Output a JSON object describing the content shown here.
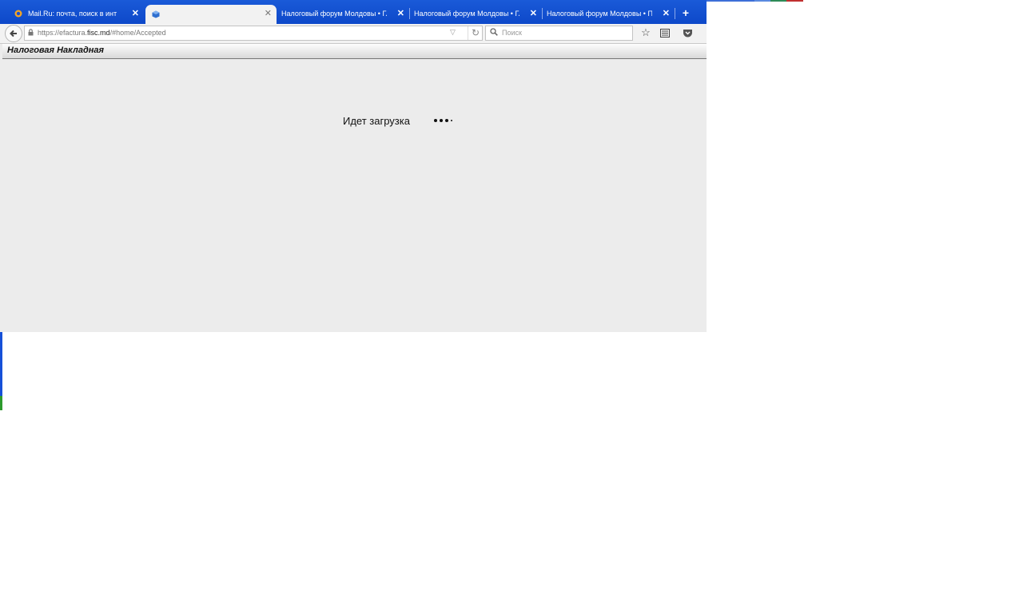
{
  "browser": {
    "tabs": [
      {
        "label": "Mail.Ru: почта, поиск в инт",
        "active": false,
        "icon": "mailru-icon"
      },
      {
        "label": "",
        "active": true,
        "icon": "box-icon"
      },
      {
        "label": "Налоговый форум Молдовы • Гл",
        "active": false
      },
      {
        "label": "Налоговый форум Молдовы • Гл",
        "active": false
      },
      {
        "label": "Налоговый форум Молдовы • Пр",
        "active": false
      }
    ],
    "new_tab_label": "+",
    "close_label": "✕",
    "url_prefix": "https://efactura.",
    "url_host": "fisc.md",
    "url_suffix": "/#home/Accepted",
    "search_placeholder": "Поиск"
  },
  "page": {
    "title": "Налоговая Накладная",
    "loading_text": "Идет загрузка"
  },
  "colors": {
    "tabstrip": "#1a5ad8",
    "content_bg": "#ececec"
  }
}
